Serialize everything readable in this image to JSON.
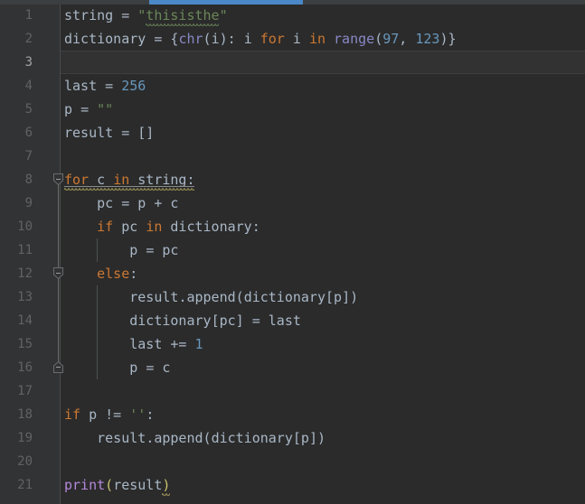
{
  "editor": {
    "theme_name": "darcula",
    "background_color": "#2b2b2b",
    "gutter_color": "#313335",
    "current_line_color": "#323232",
    "default_text_color": "#a9b7c6",
    "keyword_color": "#cc7832",
    "string_color": "#6a8759",
    "number_color": "#6897bb",
    "builtin_color": "#8888c6",
    "print_color": "#b389d9",
    "lineno_color": "#606366",
    "lineno_current_color": "#a4a3a3",
    "tab_indicator_color": "#4a88c7",
    "fold_line_color": "#6b6b6b",
    "indent_guide_color": "#4e5254",
    "current_line_number": "3"
  },
  "line_numbers": [
    "1",
    "2",
    "3",
    "4",
    "5",
    "6",
    "7",
    "8",
    "9",
    "10",
    "11",
    "12",
    "13",
    "14",
    "15",
    "16",
    "17",
    "18",
    "19",
    "20",
    "21"
  ],
  "fold_markers": [
    {
      "name": "fold-marker-for-loop",
      "line": 8,
      "state": "expanded",
      "glyph": "minus"
    },
    {
      "name": "fold-marker-else-block",
      "line": 12,
      "state": "expanded",
      "glyph": "minus"
    },
    {
      "name": "fold-region-end",
      "line": 16,
      "state": "end-cap",
      "glyph": "minus"
    }
  ],
  "code_lines": [
    {
      "number": "1",
      "text": "string = \"thisisthe\""
    },
    {
      "number": "2",
      "text": "dictionary = {chr(i): i for i in range(97, 123)}"
    },
    {
      "number": "3",
      "text": ""
    },
    {
      "number": "4",
      "text": "last = 256"
    },
    {
      "number": "5",
      "text": "p = \"\""
    },
    {
      "number": "6",
      "text": "result = []"
    },
    {
      "number": "7",
      "text": ""
    },
    {
      "number": "8",
      "text": "for c in string:"
    },
    {
      "number": "9",
      "text": "    pc = p + c"
    },
    {
      "number": "10",
      "text": "    if pc in dictionary:"
    },
    {
      "number": "11",
      "text": "        p = pc"
    },
    {
      "number": "12",
      "text": "    else:"
    },
    {
      "number": "13",
      "text": "        result.append(dictionary[p])"
    },
    {
      "number": "14",
      "text": "        dictionary[pc] = last"
    },
    {
      "number": "15",
      "text": "        last += 1"
    },
    {
      "number": "16",
      "text": "        p = c"
    },
    {
      "number": "17",
      "text": ""
    },
    {
      "number": "18",
      "text": "if p != '':"
    },
    {
      "number": "19",
      "text": "    result.append(dictionary[p])"
    },
    {
      "number": "20",
      "text": ""
    },
    {
      "number": "21",
      "text": "print(result)"
    }
  ],
  "annotations": [
    {
      "name": "spellcheck-squiggle-thisisthe",
      "line": 1,
      "color": "#6a8759",
      "type": "wavy-underline",
      "target": "thisisthe"
    },
    {
      "name": "inspection-underline-for-statement",
      "line": 8,
      "color": "#8a8a8a",
      "type": "solid-underline",
      "target": "for c in string:"
    },
    {
      "name": "inspection-squiggle-for-statement",
      "line": 8,
      "color": "#a9a15c",
      "type": "wavy-underline",
      "target": "for c in string:"
    },
    {
      "name": "inspection-squiggle-print-paren",
      "line": 21,
      "color": "#a9a15c",
      "type": "wavy-underline",
      "target": ")"
    }
  ],
  "tab": {
    "name": "active-file-tab-indicator",
    "state": "active"
  }
}
